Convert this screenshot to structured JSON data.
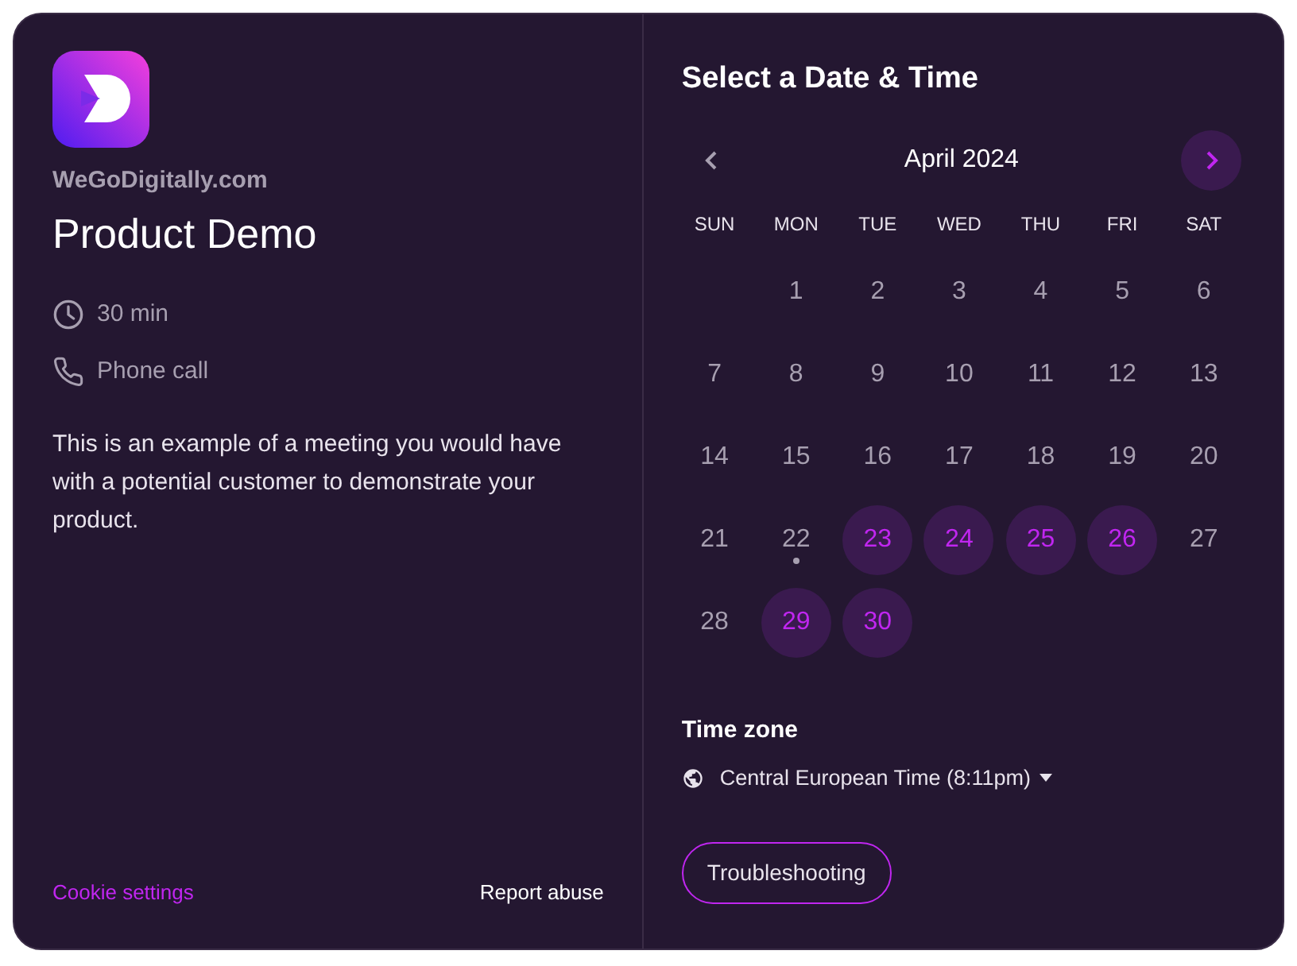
{
  "event": {
    "organization": "WeGoDigitally.com",
    "title": "Product Demo",
    "details": [
      {
        "kind": "duration",
        "label": "30 min"
      },
      {
        "kind": "phone",
        "label": "Phone call"
      }
    ],
    "description": "This is an example of a meeting you would have with a potential customer to demonstrate your product."
  },
  "footer_links": [
    {
      "label": "Cookie settings",
      "kind": "accent"
    },
    {
      "label": "Report abuse",
      "kind": "plain"
    }
  ],
  "scheduler": {
    "title": "Select a Date & Time",
    "month": "April 2024",
    "prev_disabled": true,
    "next_disabled": false,
    "weekdays": [
      "SUN",
      "MON",
      "TUE",
      "WED",
      "THU",
      "FRI",
      "SAT"
    ],
    "weeks": [
      [
        {
          "kind": "empty"
        },
        {
          "kind": "day",
          "label": "1",
          "available": false,
          "today": false
        },
        {
          "kind": "day",
          "label": "2",
          "available": false,
          "today": false
        },
        {
          "kind": "day",
          "label": "3",
          "available": false,
          "today": false
        },
        {
          "kind": "day",
          "label": "4",
          "available": false,
          "today": false
        },
        {
          "kind": "day",
          "label": "5",
          "available": false,
          "today": false
        },
        {
          "kind": "day",
          "label": "6",
          "available": false,
          "today": false
        }
      ],
      [
        {
          "kind": "day",
          "label": "7",
          "available": false,
          "today": false
        },
        {
          "kind": "day",
          "label": "8",
          "available": false,
          "today": false
        },
        {
          "kind": "day",
          "label": "9",
          "available": false,
          "today": false
        },
        {
          "kind": "day",
          "label": "10",
          "available": false,
          "today": false
        },
        {
          "kind": "day",
          "label": "11",
          "available": false,
          "today": false
        },
        {
          "kind": "day",
          "label": "12",
          "available": false,
          "today": false
        },
        {
          "kind": "day",
          "label": "13",
          "available": false,
          "today": false
        }
      ],
      [
        {
          "kind": "day",
          "label": "14",
          "available": false,
          "today": false
        },
        {
          "kind": "day",
          "label": "15",
          "available": false,
          "today": false
        },
        {
          "kind": "day",
          "label": "16",
          "available": false,
          "today": false
        },
        {
          "kind": "day",
          "label": "17",
          "available": false,
          "today": false
        },
        {
          "kind": "day",
          "label": "18",
          "available": false,
          "today": false
        },
        {
          "kind": "day",
          "label": "19",
          "available": false,
          "today": false
        },
        {
          "kind": "day",
          "label": "20",
          "available": false,
          "today": false
        }
      ],
      [
        {
          "kind": "day",
          "label": "21",
          "available": false,
          "today": false
        },
        {
          "kind": "day",
          "label": "22",
          "available": false,
          "today": true
        },
        {
          "kind": "day",
          "label": "23",
          "available": true,
          "today": false
        },
        {
          "kind": "day",
          "label": "24",
          "available": true,
          "today": false
        },
        {
          "kind": "day",
          "label": "25",
          "available": true,
          "today": false
        },
        {
          "kind": "day",
          "label": "26",
          "available": true,
          "today": false
        },
        {
          "kind": "day",
          "label": "27",
          "available": false,
          "today": false
        }
      ],
      [
        {
          "kind": "day",
          "label": "28",
          "available": false,
          "today": false
        },
        {
          "kind": "day",
          "label": "29",
          "available": true,
          "today": false
        },
        {
          "kind": "day",
          "label": "30",
          "available": true,
          "today": false
        }
      ]
    ],
    "timezone_label": "Time zone",
    "timezone": "Central European Time (8:11pm)",
    "troubleshoot_button": "Troubleshooting"
  }
}
